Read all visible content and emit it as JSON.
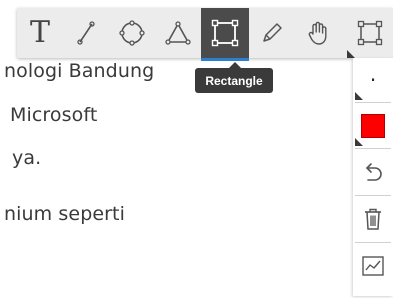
{
  "document": {
    "lines": [
      "nologi Bandung",
      "Microsoft",
      "ya.",
      "nium seperti"
    ]
  },
  "toolbar": {
    "tools": [
      {
        "name": "text",
        "icon": "text-icon",
        "glyph": "T"
      },
      {
        "name": "line",
        "icon": "line-icon"
      },
      {
        "name": "ellipse",
        "icon": "ellipse-icon"
      },
      {
        "name": "triangle",
        "icon": "triangle-icon"
      },
      {
        "name": "rectangle",
        "icon": "rectangle-icon",
        "active": true
      },
      {
        "name": "pencil",
        "icon": "pencil-icon"
      },
      {
        "name": "hand",
        "icon": "hand-icon"
      },
      {
        "name": "selection",
        "icon": "selection-icon"
      }
    ],
    "tooltip": "Rectangle"
  },
  "sidebar": {
    "stroke_dot": "·",
    "color": "#ff0000",
    "items": [
      "stroke-size",
      "color-picker",
      "undo",
      "delete",
      "chart"
    ]
  },
  "colors": {
    "toolbar_bg": "#ececec",
    "active_bg": "#4b4b4b",
    "accent": "#2f7fcf",
    "tooltip_bg": "#3a3a3a",
    "selected_color": "#ff0000"
  }
}
